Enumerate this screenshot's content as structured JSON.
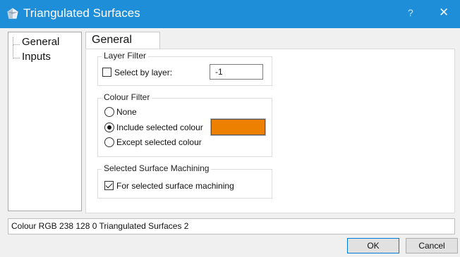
{
  "window": {
    "title": "Triangulated Surfaces",
    "help_glyph": "?",
    "close_glyph": "✕",
    "accent_color": "#1e8ed8"
  },
  "tree": {
    "items": [
      {
        "label": "General"
      },
      {
        "label": "Inputs"
      }
    ]
  },
  "tab": {
    "label": "General"
  },
  "layer_filter": {
    "group_label": "Layer Filter",
    "checkbox_label": "Select by layer:",
    "checked": false,
    "value": "-1"
  },
  "colour_filter": {
    "group_label": "Colour Filter",
    "options": [
      {
        "label": "None",
        "selected": false
      },
      {
        "label": "Include selected colour",
        "selected": true
      },
      {
        "label": "Except selected colour",
        "selected": false
      }
    ],
    "swatch_color": "#ee8000"
  },
  "surface_machining": {
    "group_label": "Selected Surface Machining",
    "checkbox_label": "For selected surface machining",
    "checked": true
  },
  "status_bar": {
    "text": "Colour RGB 238 128 0 Triangulated Surfaces 2"
  },
  "buttons": {
    "ok": "OK",
    "cancel": "Cancel"
  }
}
